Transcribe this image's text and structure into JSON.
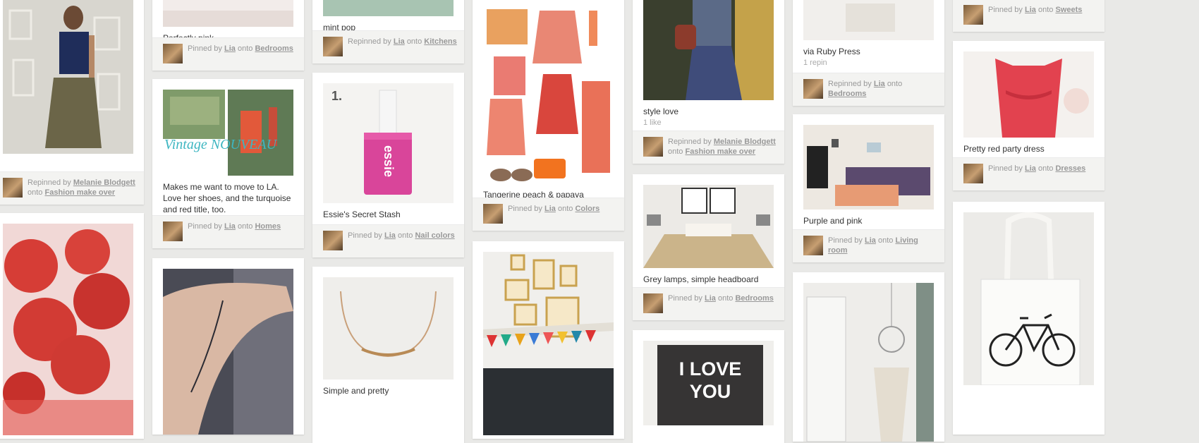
{
  "pins": {
    "c0p0": {
      "desc": "",
      "by": "Repinned by",
      "user": "Melanie Blodgett",
      "onto": "onto",
      "board": "Fashion make over"
    },
    "c1p0": {
      "desc": "Perfectly pink",
      "by": "Pinned by",
      "user": "Lia",
      "onto": "onto",
      "board": "Bedrooms"
    },
    "c1p1": {
      "desc": "Makes me want to move to LA. Love her shoes, and the turquoise and red title, too.",
      "by": "Pinned by",
      "user": "Lia",
      "onto": "onto",
      "board": "Homes",
      "img_text": "Vintage NOUVEAU"
    },
    "c2p0": {
      "desc": "mint pop",
      "by": "Repinned by",
      "user": "Lia",
      "onto": "onto",
      "board": "Kitchens"
    },
    "c2p1": {
      "desc": "Essie's Secret Stash",
      "by": "Pinned by",
      "user": "Lia",
      "onto": "onto",
      "board": "Nail colors",
      "img_text": "1.",
      "brand": "essie"
    },
    "c2p2": {
      "desc": "Simple and pretty"
    },
    "c3p0": {
      "desc": "Tangerine peach & papaya",
      "by": "Pinned by",
      "user": "Lia",
      "onto": "onto",
      "board": "Colors"
    },
    "c4p0": {
      "desc": "style love",
      "meta": "1 like",
      "by": "Repinned by",
      "user": "Melanie Blodgett",
      "onto": "onto",
      "board": "Fashion make over"
    },
    "c4p1": {
      "desc": "Grey lamps, simple headboard",
      "by": "Pinned by",
      "user": "Lia",
      "onto": "onto",
      "board": "Bedrooms"
    },
    "c4p2": {
      "img_text": "I LOVE YOU"
    },
    "c5p0": {
      "desc": "via Ruby Press",
      "meta": "1 repin",
      "by": "Repinned by",
      "user": "Lia",
      "onto": "onto",
      "board": "Bedrooms"
    },
    "c5p1": {
      "desc": "Purple and pink",
      "by": "Pinned by",
      "user": "Lia",
      "onto": "onto",
      "board": "Living room"
    },
    "c6p0": {
      "by": "Pinned by",
      "user": "Lia",
      "onto": "onto",
      "board": "Sweets"
    },
    "c6p1": {
      "desc": "Pretty red party dress",
      "by": "Pinned by",
      "user": "Lia",
      "onto": "onto",
      "board": "Dresses"
    }
  },
  "colors": {
    "background": "#e9e9e7",
    "card": "#ffffff",
    "attribution": "#f3f3f1"
  }
}
